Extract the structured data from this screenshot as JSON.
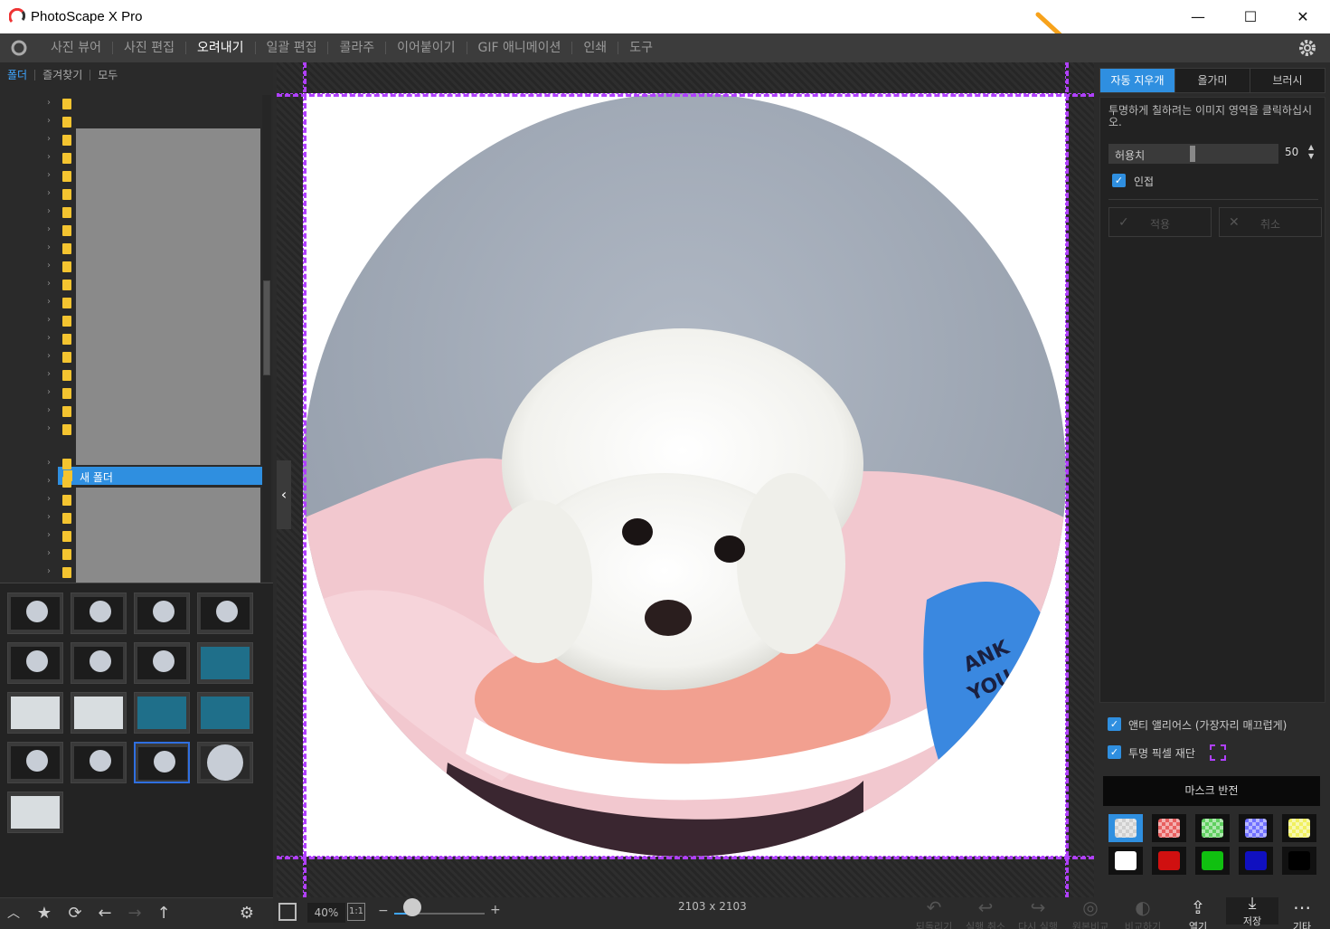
{
  "app": {
    "title": "PhotoScape X Pro"
  },
  "window": {
    "minimize": "—",
    "maximize": "☐",
    "close": "✕"
  },
  "menu": {
    "items": [
      "사진 뷰어",
      "사진 편집",
      "오려내기",
      "일괄 편집",
      "콜라주",
      "이어붙이기",
      "GIF 애니메이션",
      "인쇄",
      "도구"
    ],
    "active_index": 2
  },
  "left": {
    "tabs": [
      "폴더",
      "즐겨찾기",
      "모두"
    ],
    "selected_folder": "새 폴더"
  },
  "bottom": {
    "zoom": "40%",
    "one_to_one": "1:1",
    "minus": "−",
    "plus": "+",
    "zoom_level": 0.2,
    "dimensions": "2103 x 2103",
    "actions": {
      "undo_all": "되돌리기",
      "undo": "실행 취소",
      "redo": "다시 실행",
      "original": "원본비교",
      "compare": "비교하기",
      "open": "열기",
      "save": "저장",
      "more": "기타"
    }
  },
  "right": {
    "tabs": [
      "자동 지우개",
      "올가미",
      "브러시"
    ],
    "active_tab": 0,
    "hint": "투명하게 칠하려는 이미지 영역을 클릭하십시오.",
    "tolerance_label": "허용치",
    "tolerance_value": "50",
    "contiguous_label": "인접",
    "apply_label": "적용",
    "cancel_label": "취소",
    "antialias_label": "앤티 앨리어스 (가장자리 매끄럽게)",
    "crop_transparent_label": "투명 픽셀 재단",
    "mask_invert_label": "마스크 반전",
    "swatch_colors": [
      "#cfcfcf",
      "#e86060",
      "#60d060",
      "#7070ff",
      "#f0f060",
      "#ffffff",
      "#d01010",
      "#10c010",
      "#1010c0",
      "#000000"
    ]
  },
  "colors": {
    "accent": "#2f8fe0",
    "arrow": "#f7a21b"
  }
}
